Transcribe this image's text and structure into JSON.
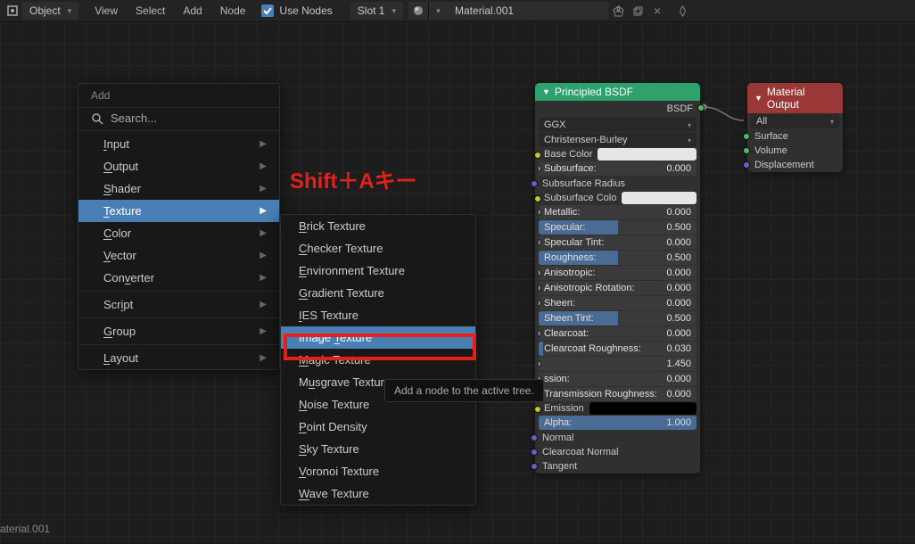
{
  "header": {
    "mode": "Object",
    "menus": [
      "View",
      "Select",
      "Add",
      "Node"
    ],
    "use_nodes_label": "Use Nodes",
    "slot": "Slot 1",
    "material_name": "Material.001"
  },
  "annotation": "Shift＋Aキー",
  "tooltip": "Add a node to the active tree.",
  "add_menu": {
    "title": "Add",
    "search": "Search...",
    "items": [
      {
        "label": "Input",
        "u": 0
      },
      {
        "label": "Output",
        "u": 0
      },
      {
        "label": "Shader",
        "u": 0
      },
      {
        "label": "Texture",
        "u": 0,
        "active": true
      },
      {
        "label": "Color",
        "u": 0
      },
      {
        "label": "Vector",
        "u": 0
      },
      {
        "label": "Converter",
        "u": 3
      },
      {
        "label": "Script",
        "u": 3
      },
      {
        "label": "Group",
        "u": 0
      },
      {
        "label": "Layout",
        "u": 0
      }
    ]
  },
  "texture_submenu": [
    {
      "label": "Brick Texture",
      "u": 0
    },
    {
      "label": "Checker Texture",
      "u": 0
    },
    {
      "label": "Environment Texture",
      "u": 0
    },
    {
      "label": "Gradient Texture",
      "u": 0
    },
    {
      "label": "IES Texture",
      "u": 0
    },
    {
      "label": "Image Texture",
      "u": 6,
      "active": true,
      "highlight": true
    },
    {
      "label": "Magic Texture",
      "u": 0
    },
    {
      "label": "Musgrave Texture",
      "u": 1
    },
    {
      "label": "Noise Texture",
      "u": 0
    },
    {
      "label": "Point Density",
      "u": 0
    },
    {
      "label": "Sky Texture",
      "u": 0
    },
    {
      "label": "Voronoi Texture",
      "u": 0
    },
    {
      "label": "Wave Texture",
      "u": 0
    }
  ],
  "bsdf": {
    "title": "Principled BSDF",
    "out": "BSDF",
    "dist": "GGX",
    "sss": "Christensen-Burley",
    "base_color_label": "Base Color",
    "props": [
      {
        "name": "Subsurface:",
        "val": "0.000",
        "fill": 0,
        "sock": "grey"
      },
      {
        "name": "Subsurface Radius",
        "type": "label",
        "sock": "blue"
      },
      {
        "name": "Subsurface Colo",
        "type": "color",
        "sock": "yellow",
        "swatch": "#e6e6e6"
      },
      {
        "name": "Metallic:",
        "val": "0.000",
        "fill": 0,
        "sock": "grey"
      },
      {
        "name": "Specular:",
        "val": "0.500",
        "fill": 0.5,
        "sock": "grey"
      },
      {
        "name": "Specular Tint:",
        "val": "0.000",
        "fill": 0,
        "sock": "grey"
      },
      {
        "name": "Roughness:",
        "val": "0.500",
        "fill": 0.5,
        "sock": "grey"
      },
      {
        "name": "Anisotropic:",
        "val": "0.000",
        "fill": 0,
        "sock": "grey"
      },
      {
        "name": "Anisotropic Rotation:",
        "val": "0.000",
        "fill": 0,
        "sock": "grey"
      },
      {
        "name": "Sheen:",
        "val": "0.000",
        "fill": 0,
        "sock": "grey"
      },
      {
        "name": "Sheen Tint:",
        "val": "0.500",
        "fill": 0.5,
        "sock": "grey"
      },
      {
        "name": "Clearcoat:",
        "val": "0.000",
        "fill": 0,
        "sock": "grey"
      },
      {
        "name": "Clearcoat Roughness:",
        "val": "0.030",
        "fill": 0.03,
        "sock": "grey"
      },
      {
        "name": "",
        "val": "1.450",
        "fill": 0,
        "sock": "grey",
        "nolabel": true
      },
      {
        "name": "ssion:",
        "val": "0.000",
        "fill": 0,
        "sock": "grey"
      },
      {
        "name": "Transmission Roughness:",
        "val": "0.000",
        "fill": 0,
        "sock": "grey"
      },
      {
        "name": "Emission",
        "type": "colorblack",
        "sock": "yellow"
      },
      {
        "name": "Alpha:",
        "val": "1.000",
        "fill": 1.0,
        "sock": "grey"
      },
      {
        "name": "Normal",
        "type": "label",
        "sock": "blue"
      },
      {
        "name": "Clearcoat Normal",
        "type": "label",
        "sock": "blue"
      },
      {
        "name": "Tangent",
        "type": "label",
        "sock": "blue"
      }
    ]
  },
  "matout": {
    "title": "Material Output",
    "target": "All",
    "ins": [
      "Surface",
      "Volume",
      "Displacement"
    ]
  },
  "footer_label": "aterial.001"
}
